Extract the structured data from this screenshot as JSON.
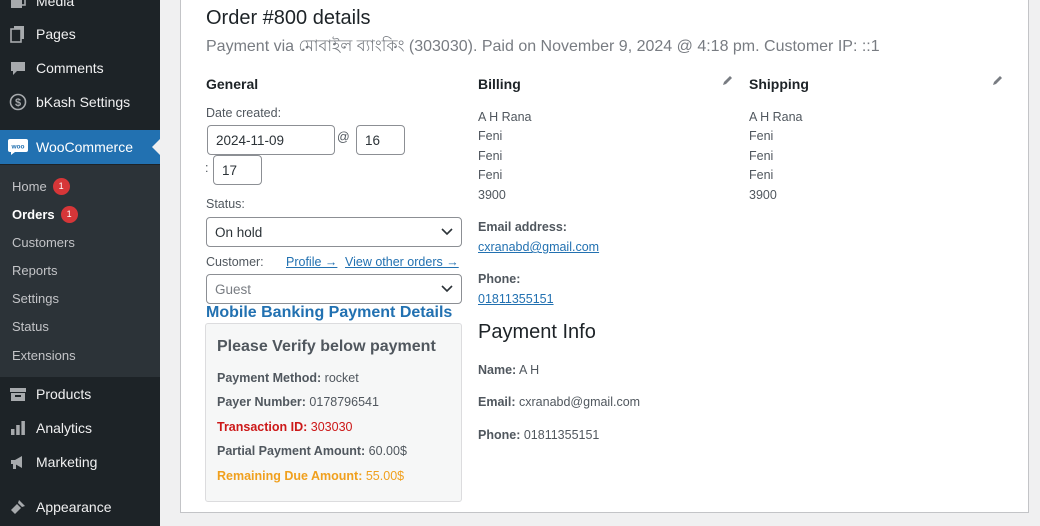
{
  "sidebar": {
    "menu": [
      {
        "label": "Media",
        "icon": "media-icon"
      },
      {
        "label": "Pages",
        "icon": "pages-icon"
      },
      {
        "label": "Comments",
        "icon": "comments-icon"
      },
      {
        "label": "bKash Settings",
        "icon": "dollar-icon"
      },
      {
        "label": "WooCommerce",
        "icon": "woo-icon"
      },
      {
        "label": "Products",
        "icon": "products-icon"
      },
      {
        "label": "Analytics",
        "icon": "analytics-icon"
      },
      {
        "label": "Marketing",
        "icon": "marketing-icon"
      },
      {
        "label": "Appearance",
        "icon": "appearance-icon"
      }
    ],
    "woo_badge": "woo",
    "submenu": [
      {
        "label": "Home",
        "count": "1"
      },
      {
        "label": "Orders",
        "count": "1"
      },
      {
        "label": "Customers"
      },
      {
        "label": "Reports"
      },
      {
        "label": "Settings"
      },
      {
        "label": "Status"
      },
      {
        "label": "Extensions"
      }
    ]
  },
  "order": {
    "title": "Order #800 details",
    "meta": "Payment via মোবাইল ব্যাংকিং (303030). Paid on November 9, 2024 @ 4:18 pm. Customer IP: ::1"
  },
  "general": {
    "heading": "General",
    "date_created_label": "Date created:",
    "date": "2024-11-09",
    "at": "@",
    "hour": "16",
    "colon": ":",
    "minute": "17",
    "status_label": "Status:",
    "status_value": "On hold",
    "customer_label": "Customer:",
    "profile_link": "Profile →",
    "other_orders_link": "View other orders →",
    "customer_placeholder": "Guest"
  },
  "billing": {
    "heading": "Billing",
    "address": [
      "A H Rana",
      "Feni",
      "Feni",
      "Feni",
      "3900"
    ],
    "email_label": "Email address:",
    "email": "cxranabd@gmail.com",
    "phone_label": "Phone:",
    "phone": "01811355151"
  },
  "shipping": {
    "heading": "Shipping",
    "address": [
      "A H Rana",
      "Feni",
      "Feni",
      "Feni",
      "3900"
    ]
  },
  "mobile_banking": {
    "title": "Mobile Banking Payment Details",
    "heading": "Please Verify below payment",
    "rows": [
      {
        "label": "Payment Method:",
        "value": "rocket"
      },
      {
        "label": "Payer Number:",
        "value": "0178796541"
      },
      {
        "label": "Transaction ID:",
        "value": "303030"
      },
      {
        "label": "Partial Payment Amount:",
        "value": "60.00$"
      },
      {
        "label": "Remaining Due Amount:",
        "value": "55.00$"
      }
    ]
  },
  "payment_info": {
    "title": "Payment Info",
    "rows": [
      {
        "label": "Name:",
        "value": "A H"
      },
      {
        "label": "Email:",
        "value": "cxranabd@gmail.com"
      },
      {
        "label": "Phone:",
        "value": "01811355151"
      }
    ]
  },
  "colors": {
    "sidebar_bg": "#1d2327",
    "submenu_bg": "#2c3338",
    "accent": "#2271b1",
    "badge": "#d63638",
    "transaction_red": "#cc1818",
    "remaining_orange": "#f0a01e"
  }
}
